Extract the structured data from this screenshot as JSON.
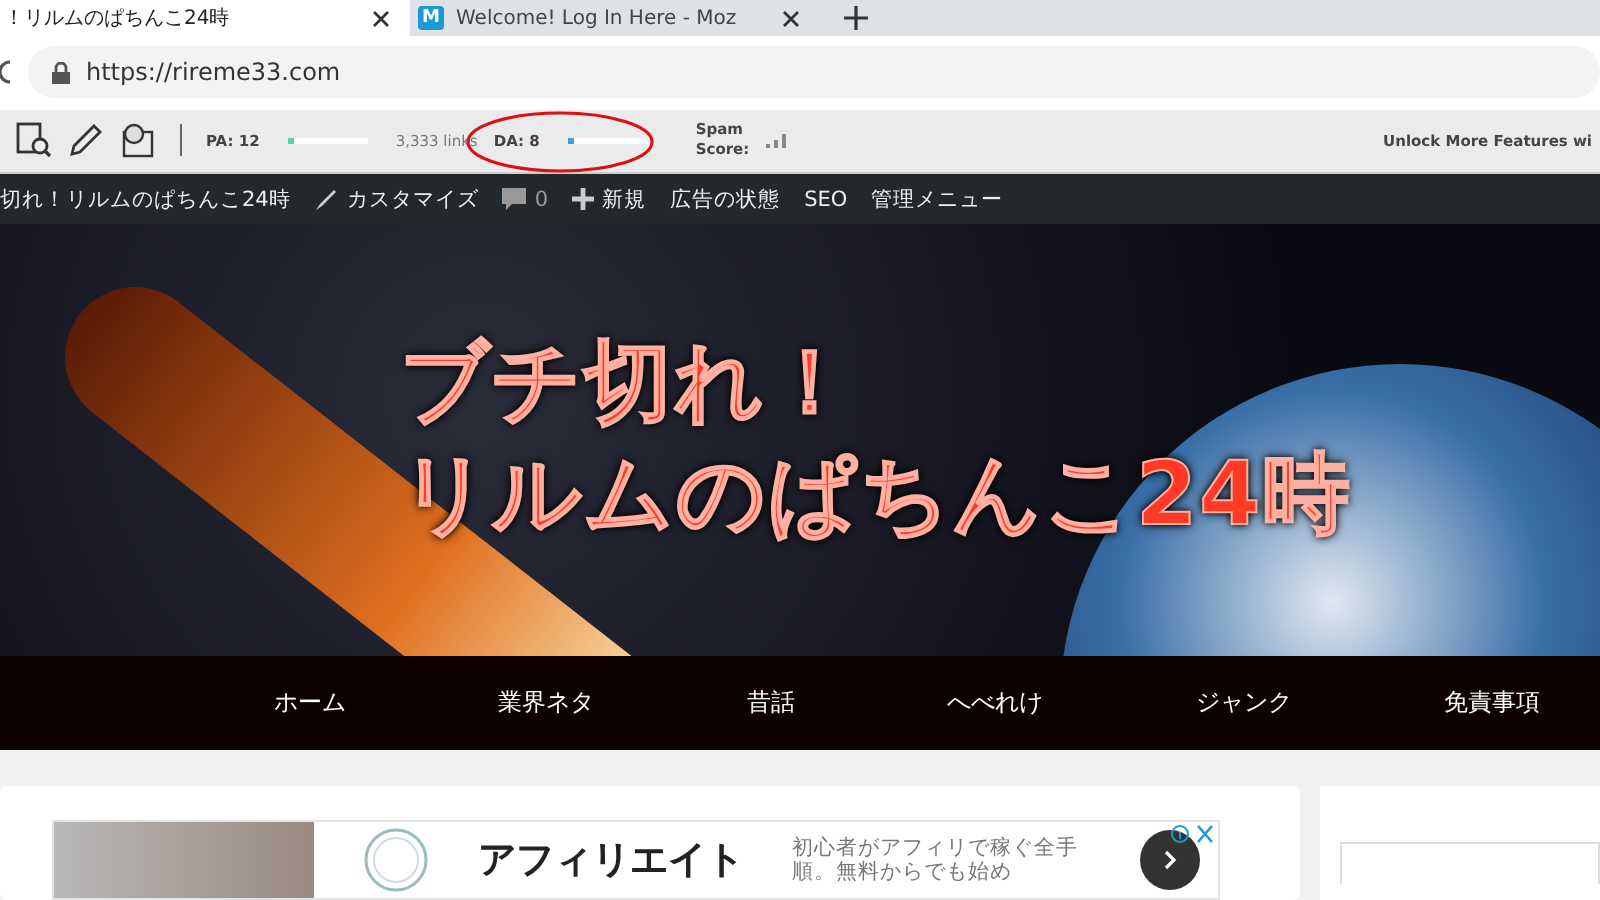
{
  "tabs": [
    {
      "title": "！リルムのぱちんこ24時",
      "selected": true
    },
    {
      "logo_letter": "M",
      "title": "Welcome! Log In Here - Moz",
      "selected": false
    }
  ],
  "address_bar": {
    "url": "https://rireme33.com"
  },
  "moz_bar": {
    "pa": {
      "label": "PA: 12",
      "level": 0.05
    },
    "links": "3,333 links",
    "da": {
      "label": "DA: 8",
      "level": 0.05
    },
    "spam_label": [
      "Spam",
      "Score:"
    ],
    "unlock": "Unlock More Features wi"
  },
  "admin_bar": {
    "items": [
      {
        "kind": "site",
        "label": "切れ！リルムのぱちんこ24時"
      },
      {
        "kind": "customize",
        "label": "カスタマイズ"
      },
      {
        "kind": "comments",
        "label": "0"
      },
      {
        "kind": "new",
        "label": "新規"
      },
      {
        "kind": "plain",
        "label": "広告の状態"
      },
      {
        "kind": "plain",
        "label": "SEO"
      },
      {
        "kind": "plain",
        "label": "管理メニュー"
      }
    ]
  },
  "header": {
    "title_lines": [
      "ブチ切れ！",
      "リルムのぱちんこ24時"
    ]
  },
  "nav": {
    "items": [
      "ホーム",
      "業界ネタ",
      "昔話",
      "へべれけ",
      "ジャンク",
      "免責事項"
    ]
  },
  "ad": {
    "heading": "アフィリエイト",
    "text": "初心者がアフィリで稼ぐ全手順。無料からでも始め"
  }
}
